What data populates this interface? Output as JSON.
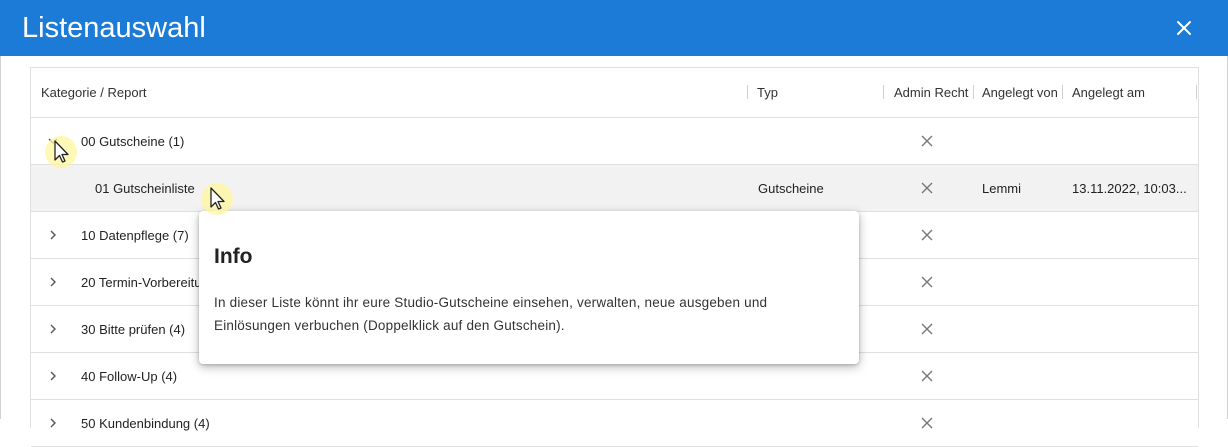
{
  "dialog": {
    "title": "Listenauswahl",
    "close_icon": "close-icon",
    "header_color": "#1c7bd6"
  },
  "table": {
    "columns": [
      "Kategorie / Report",
      "Typ",
      "Admin Recht",
      "Angelegt von",
      "Angelegt am"
    ],
    "rows": [
      {
        "label": "00 Gutscheine (1)",
        "typ": "",
        "admin": "x",
        "angelegt_von": "",
        "angelegt_am": "",
        "expanded": true
      },
      {
        "label": "01 Gutscheinliste",
        "typ": "Gutscheine",
        "admin": "x",
        "angelegt_von": "Lemmi",
        "angelegt_am": "13.11.2022, 10:03...",
        "selected": true
      },
      {
        "label": "10 Datenpflege (7)",
        "typ": "",
        "admin": "x",
        "angelegt_von": "",
        "angelegt_am": ""
      },
      {
        "label": "20 Termin-Vorbereitung",
        "typ": "",
        "admin": "x",
        "angelegt_von": "",
        "angelegt_am": ""
      },
      {
        "label": "30 Bitte prüfen (4)",
        "typ": "",
        "admin": "x",
        "angelegt_von": "",
        "angelegt_am": ""
      },
      {
        "label": "40 Follow-Up (4)",
        "typ": "",
        "admin": "x",
        "angelegt_von": "",
        "angelegt_am": ""
      },
      {
        "label": "50 Kundenbindung (4)",
        "typ": "",
        "admin": "x",
        "angelegt_von": "",
        "angelegt_am": ""
      }
    ]
  },
  "info_popup": {
    "title": "Info",
    "text_line1": "In dieser Liste könnt ihr eure Studio-Gutscheine einsehen, verwalten, neue ausgeben und",
    "text_line2": "Einlösungen verbuchen (Doppelklick auf den Gutschein)."
  }
}
